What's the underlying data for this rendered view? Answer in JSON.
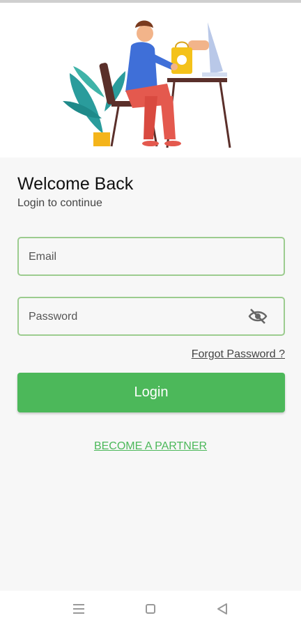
{
  "hero": {
    "illustration": "person-shopping-online-illustration"
  },
  "header": {
    "title": "Welcome Back",
    "subtitle": "Login to continue"
  },
  "form": {
    "email_placeholder": "Email",
    "password_placeholder": "Password",
    "forgot_label": "Forgot Password ?",
    "login_label": "Login",
    "partner_label": "BECOME A PARTNER"
  },
  "icons": {
    "password_toggle": "eye-off-icon",
    "nav_menu": "menu-icon",
    "nav_home": "square-home-icon",
    "nav_back": "back-triangle-icon"
  },
  "colors": {
    "accent": "#4cb85a",
    "field_border": "#9ccc8f",
    "background": "#f7f7f7"
  }
}
